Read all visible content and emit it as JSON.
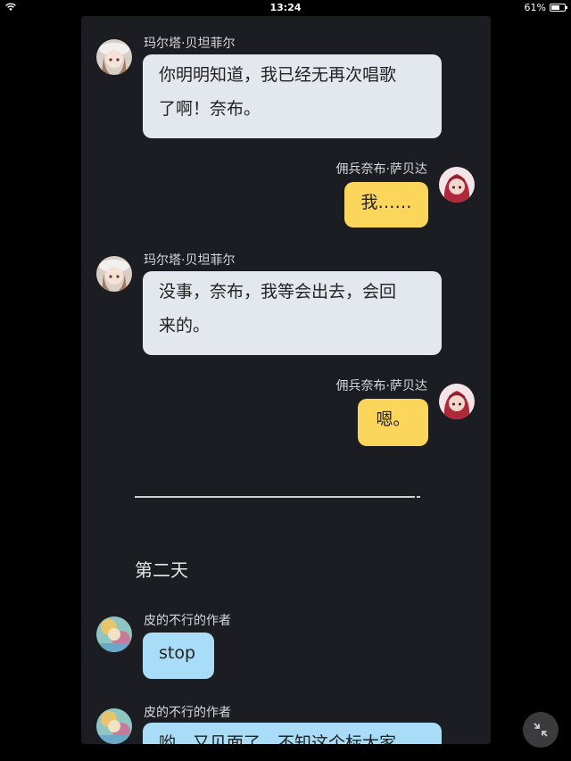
{
  "status_bar": {
    "time": "13:24",
    "battery": "61%",
    "battery_level": 0.61
  },
  "messages": [
    {
      "sender": "玛尔塔·贝坦菲尔",
      "side": "left",
      "text_lines": [
        "你明明知道，我已经无再次唱歌",
        "了啊！奈布。"
      ]
    },
    {
      "sender": "佣兵奈布·萨贝达",
      "side": "right",
      "text_lines": [
        "我……"
      ]
    },
    {
      "sender": "玛尔塔·贝坦菲尔",
      "side": "left",
      "text_lines": [
        "没事，奈布，我等会出去，会回",
        "来的。"
      ]
    },
    {
      "sender": "佣兵奈布·萨贝达",
      "side": "right",
      "text_lines": [
        "嗯。"
      ]
    },
    {
      "sender": "皮的不行的作者",
      "side": "left",
      "text_lines": [
        "stop"
      ]
    },
    {
      "sender": "皮的不行的作者",
      "side": "left",
      "text_lines": [
        "哟，又见面了，不知这个标大家"
      ]
    }
  ],
  "day_label": "第二天",
  "colors": {
    "left_bubble": "#e3e7ee",
    "right_bubble": "#fcd65a",
    "author_bubble": "#a9dcf6",
    "panel_bg": "#1c1d22"
  },
  "icons": {
    "wifi": "wifi-icon",
    "battery": "battery-icon",
    "minimize": "minimize-icon"
  }
}
